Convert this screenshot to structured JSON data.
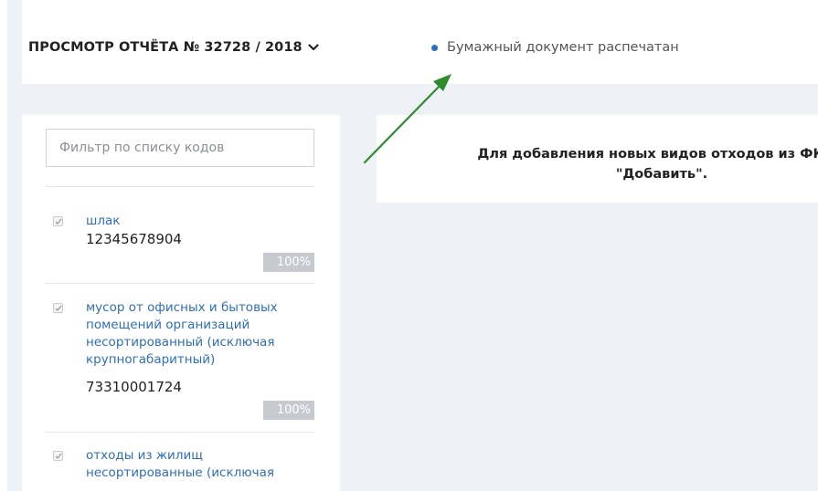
{
  "header": {
    "report_title": "ПРОСМОТР ОТЧЁТА № 32728 / 2018",
    "title_dropdown_icon": "chevron-down-icon",
    "status_text": "Бумажный документ распечатан",
    "status_dot_color": "#2c6fbf"
  },
  "sidebar": {
    "filter_placeholder": "Фильтр по списку кодов",
    "filter_value": "",
    "items": [
      {
        "name": "шлак",
        "code": "12345678904",
        "percent": "100%",
        "checked": true
      },
      {
        "name": "мусор от офисных и бытовых помещений организаций несортированный (исключая крупногабаритный)",
        "code": "73310001724",
        "percent": "100%",
        "checked": true
      },
      {
        "name": "отходы из жилищ несортированные (исключая",
        "code": "",
        "percent": "",
        "checked": true
      }
    ]
  },
  "info": {
    "line1": "Для добавления новых видов отходов из ФККО",
    "line2": "\"Добавить\"."
  },
  "annotation": {
    "arrow_color": "#2e8b2e"
  },
  "colors": {
    "link": "#2f6fb5",
    "background": "#eef1f6",
    "percent_badge": "#c6cad0"
  }
}
